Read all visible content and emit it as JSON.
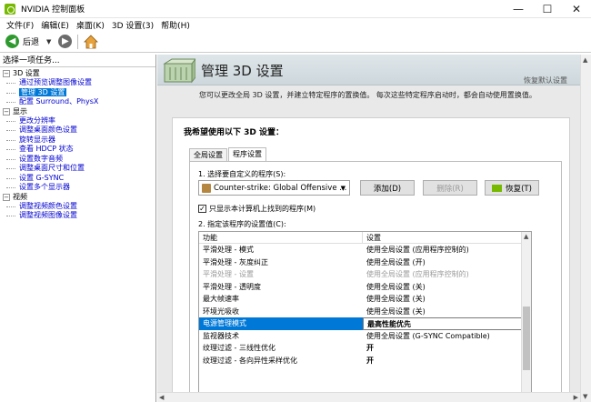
{
  "window": {
    "title": "NVIDIA 控制面板",
    "minimize": "—",
    "maximize": "☐",
    "close": "✕"
  },
  "menu": [
    "文件(F)",
    "编辑(E)",
    "桌面(K)",
    "3D 设置(3)",
    "帮助(H)"
  ],
  "toolbar": {
    "back_label": "后退"
  },
  "left": {
    "header": "选择一项任务...",
    "categories": [
      {
        "label": "3D 设置",
        "items": [
          "通过预览调整图像设置",
          "管理 3D 设置",
          "配置 Surround、PhysX"
        ]
      },
      {
        "label": "显示",
        "items": [
          "更改分辨率",
          "调整桌面颜色设置",
          "旋转显示器",
          "查看 HDCP 状态",
          "设置数字音频",
          "调整桌面尺寸和位置",
          "设置 G-SYNC",
          "设置多个显示器"
        ]
      },
      {
        "label": "视频",
        "items": [
          "调整视频颜色设置",
          "调整视频图像设置"
        ]
      }
    ]
  },
  "right": {
    "title": "管理 3D 设置",
    "restore_defaults": "恢复默认设置",
    "description": "您可以更改全局 3D 设置，并建立特定程序的置换值。 每次这些特定程序启动时，都会自动使用置换值。",
    "box_title": "我希望使用以下 3D 设置：",
    "tabs": [
      "全局设置",
      "程序设置"
    ],
    "step1": "1. 选择要自定义的程序(S):",
    "program": "Counter-strike: Global Offensive ...",
    "btn_add": "添加(D)",
    "btn_remove": "删除(R)",
    "btn_restore": "恢复(T)",
    "checkbox_label": "只显示本计算机上找到的程序(M)",
    "step2": "2. 指定该程序的设置值(C):",
    "grid_header": {
      "feature": "功能",
      "setting": "设置"
    },
    "rows": [
      {
        "feature": "平滑处理 - 模式",
        "setting": "使用全局设置 (应用程序控制的)",
        "state": "normal"
      },
      {
        "feature": "平滑处理 - 灰度纠正",
        "setting": "使用全局设置 (开)",
        "state": "normal"
      },
      {
        "feature": "平滑处理 - 设置",
        "setting": "使用全局设置 (应用程序控制的)",
        "state": "disabled"
      },
      {
        "feature": "平滑处理 - 透明度",
        "setting": "使用全局设置 (关)",
        "state": "normal"
      },
      {
        "feature": "最大帧速率",
        "setting": "使用全局设置 (关)",
        "state": "normal"
      },
      {
        "feature": "环境光吸收",
        "setting": "使用全局设置 (关)",
        "state": "normal"
      },
      {
        "feature": "电源管理模式",
        "setting": "最高性能优先",
        "state": "selected"
      },
      {
        "feature": "监视器技术",
        "setting": "使用全局设置 (G-SYNC Compatible)",
        "state": "normal"
      },
      {
        "feature": "纹理过滤 - 三线性优化",
        "setting": "开",
        "state": "bold"
      },
      {
        "feature": "纹理过滤 - 各向异性采样优化",
        "setting": "开",
        "state": "bold"
      }
    ]
  }
}
